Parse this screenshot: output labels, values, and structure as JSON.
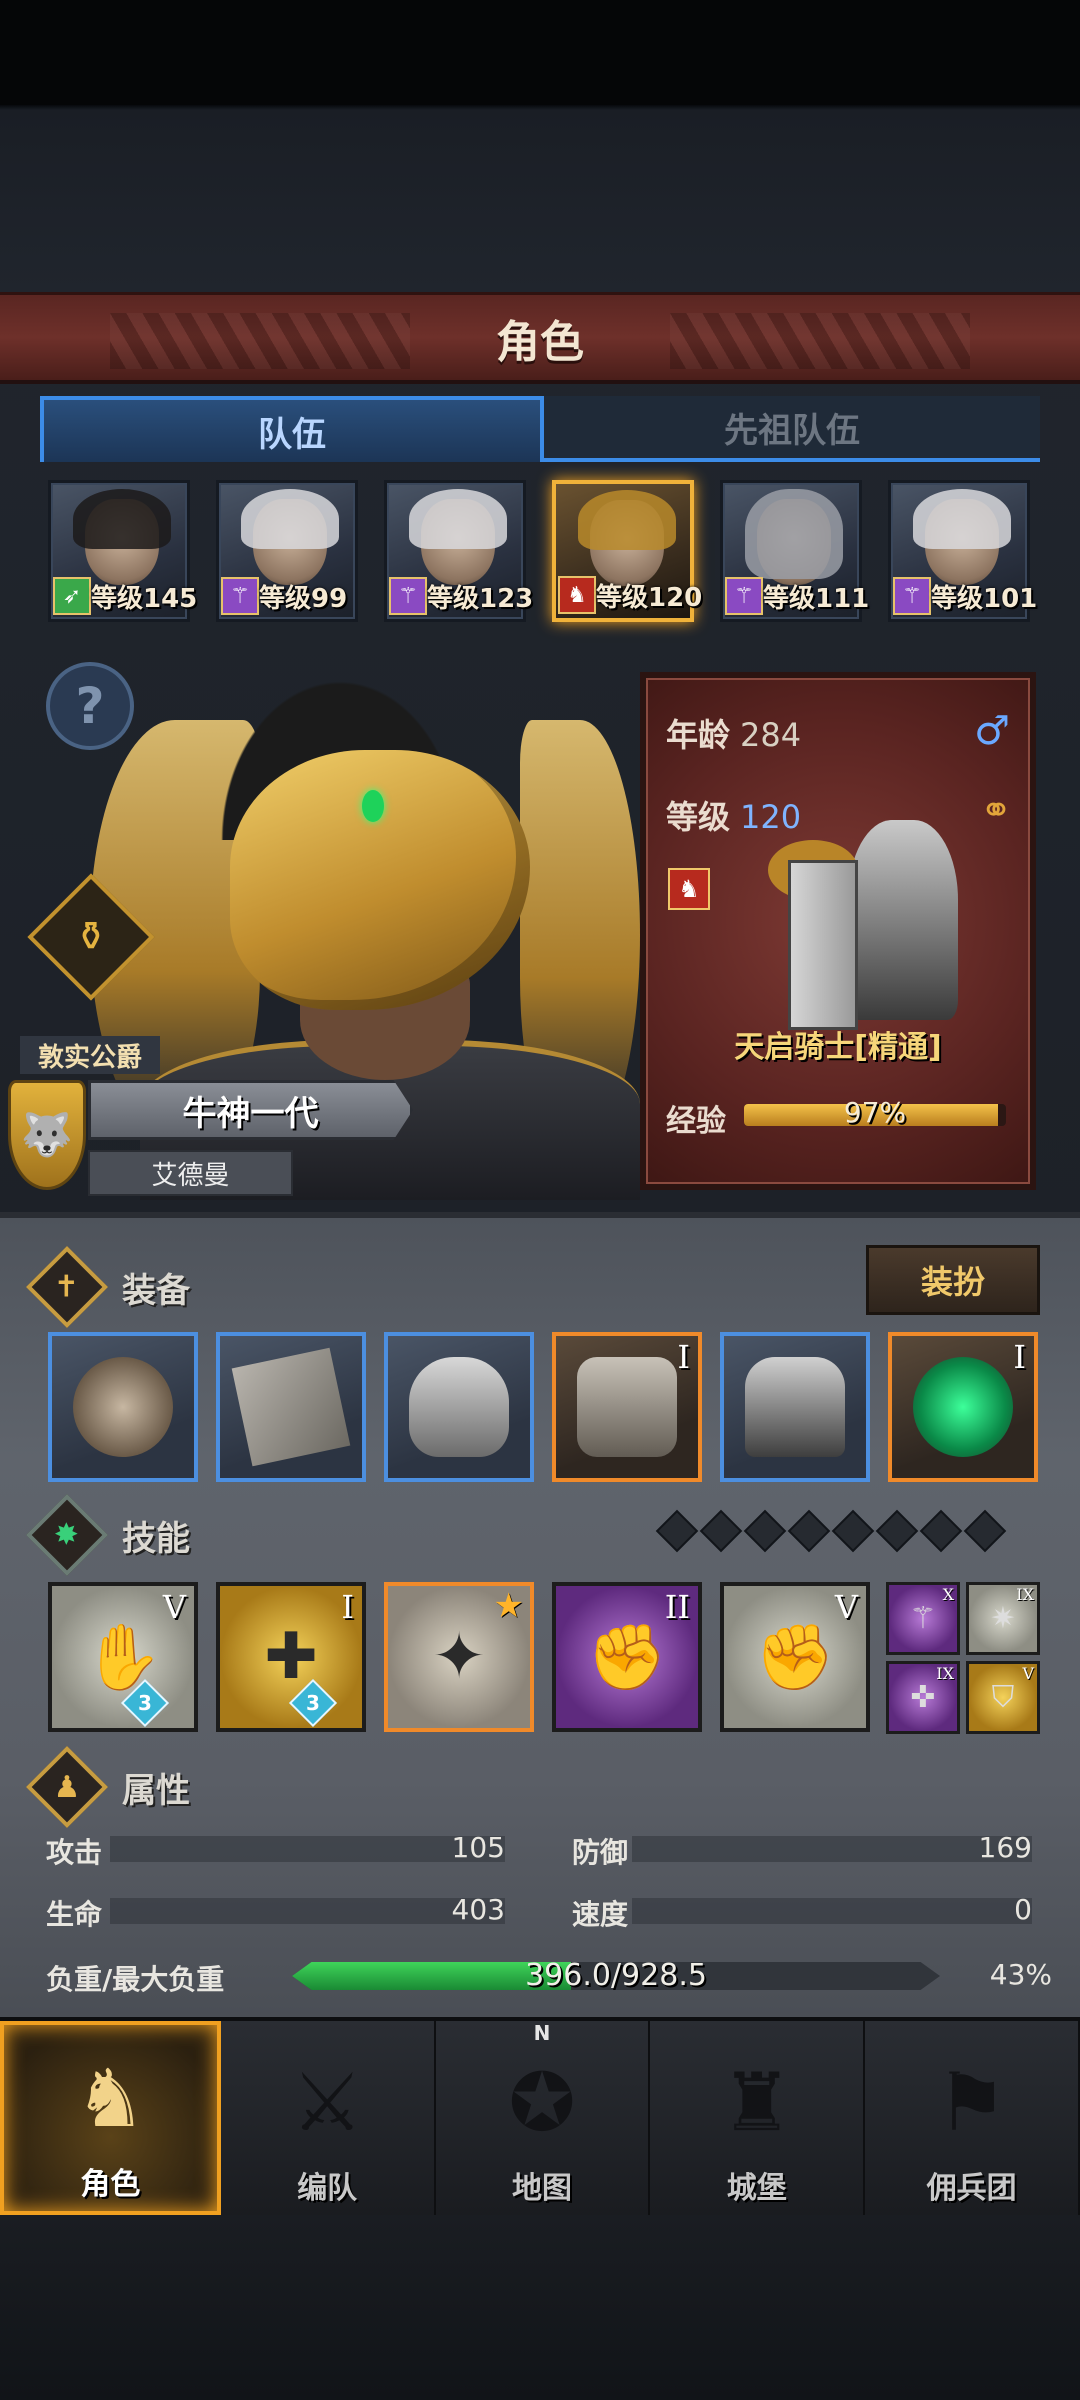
{
  "header": {
    "title": "角色"
  },
  "tabs": [
    {
      "label": "队伍",
      "active": true
    },
    {
      "label": "先祖队伍",
      "active": false
    }
  ],
  "roster": [
    {
      "level_label": "等级145",
      "class_icon": "crossbow-icon",
      "class_color": "#3aa84a",
      "hair": "dark"
    },
    {
      "level_label": "等级99",
      "class_icon": "staff-icon",
      "class_color": "#8a4ac2",
      "hair": ""
    },
    {
      "level_label": "等级123",
      "class_icon": "staff-icon",
      "class_color": "#8a4ac2",
      "hair": ""
    },
    {
      "level_label": "等级120",
      "class_icon": "horse-icon",
      "class_color": "#b72a1e",
      "hair": "gold",
      "selected": true
    },
    {
      "level_label": "等级111",
      "class_icon": "staff-icon",
      "class_color": "#8a4ac2",
      "hair": "helm"
    },
    {
      "level_label": "等级101",
      "class_icon": "staff-icon",
      "class_color": "#8a4ac2",
      "hair": ""
    }
  ],
  "hero": {
    "title": "敦实公爵",
    "name": "牛神一代",
    "origin": "艾德曼"
  },
  "info": {
    "age_label": "年龄",
    "age_value": "284",
    "level_label": "等级",
    "level_value": "120",
    "class_name": "天启骑士[精通]",
    "exp_label": "经验",
    "exp_value": "97%",
    "exp_fraction": 0.97
  },
  "equipment": {
    "label": "装备",
    "dress_button": "装扮",
    "slots": [
      {
        "art": "skull",
        "rarity": "rare",
        "tier": ""
      },
      {
        "art": "plate",
        "rarity": "rare",
        "tier": ""
      },
      {
        "art": "helm",
        "rarity": "rare",
        "tier": ""
      },
      {
        "art": "chest",
        "rarity": "legend",
        "tier": "I"
      },
      {
        "art": "boots",
        "rarity": "rare",
        "tier": ""
      },
      {
        "art": "ring",
        "rarity": "legend",
        "tier": "I"
      }
    ]
  },
  "skills": {
    "label": "技能",
    "slot_dots": 8,
    "items": [
      {
        "style": "gray",
        "tier": "V",
        "badge": "3",
        "glyph": "✋"
      },
      {
        "style": "gold",
        "tier": "I",
        "badge": "3",
        "glyph": "✚"
      },
      {
        "style": "orange",
        "tier": "",
        "star": true,
        "glyph": "✦"
      },
      {
        "style": "purple",
        "tier": "II",
        "glyph": "✊"
      },
      {
        "style": "gray",
        "tier": "V",
        "glyph": "✊"
      }
    ],
    "minis": [
      {
        "style": "p",
        "tier": "X",
        "glyph": "⚚"
      },
      {
        "style": "g",
        "tier": "IX",
        "glyph": "✷"
      },
      {
        "style": "p",
        "tier": "IX",
        "glyph": "✜"
      },
      {
        "style": "y",
        "tier": "V",
        "glyph": "⛉"
      }
    ]
  },
  "attributes": {
    "label": "属性",
    "attack_label": "攻击",
    "attack_value": "105",
    "defense_label": "防御",
    "defense_value": "169",
    "hp_label": "生命",
    "hp_value": "403",
    "speed_label": "速度",
    "speed_value": "0",
    "load_label": "负重/最大负重",
    "load_value": "396.0/928.5",
    "load_percent": "43%",
    "load_fraction": 0.43
  },
  "nav": [
    {
      "label": "角色",
      "icon": "knight-icon",
      "active": true
    },
    {
      "label": "编队",
      "icon": "formation-icon"
    },
    {
      "label": "地图",
      "icon": "compass-icon",
      "n": "N"
    },
    {
      "label": "城堡",
      "icon": "castle-icon"
    },
    {
      "label": "佣兵团",
      "icon": "banner-icon"
    }
  ],
  "colors": {
    "accent_blue": "#3c8ce8",
    "legend_orange": "#f08a2a",
    "gold": "#f0b23a"
  }
}
